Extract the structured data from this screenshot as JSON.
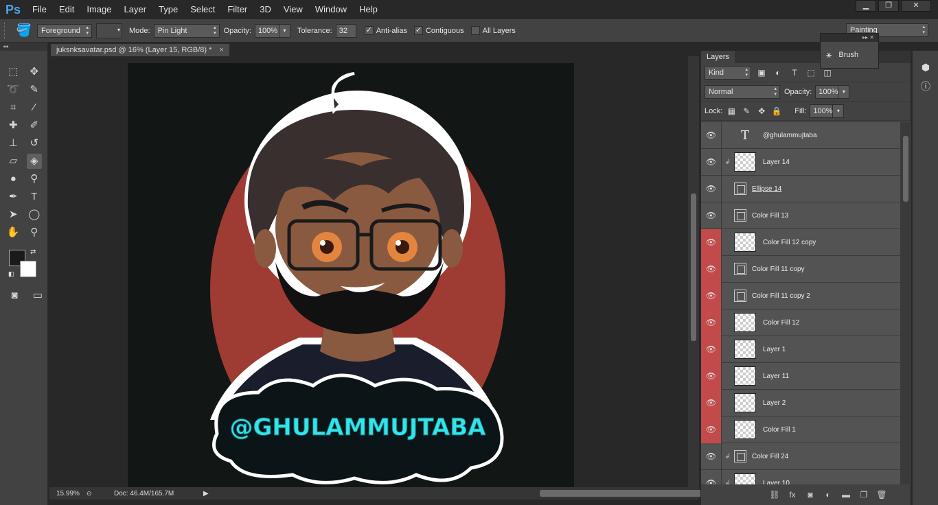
{
  "menubar": {
    "logo": "Ps",
    "items": [
      "File",
      "Edit",
      "Image",
      "Layer",
      "Type",
      "Select",
      "Filter",
      "3D",
      "View",
      "Window",
      "Help"
    ],
    "min": "▁",
    "restore": "❐",
    "close": "✕"
  },
  "options": {
    "fill_source": "Foreground",
    "mode_label": "Mode:",
    "mode_value": "Pin Light",
    "opacity_label": "Opacity:",
    "opacity_value": "100%",
    "tolerance_label": "Tolerance:",
    "tolerance_value": "32",
    "antialias_label": "Anti-alias",
    "contiguous_label": "Contiguous",
    "all_layers_label": "All Layers",
    "workspace": "Painting"
  },
  "document": {
    "tab_title": "juksnksavatar.psd @ 16% (Layer 15, RGB/8) *",
    "close": "×",
    "zoom": "15.99%",
    "doc_size": "Doc: 46.4M/165.7M",
    "artwork_handle": "@GHULAMMUJTABA"
  },
  "colors": {
    "red_circle": "#9e3b33",
    "canvas_bg": "#121614",
    "accent_cyan": "#34e4e8",
    "layer_red": "#c24a4a"
  },
  "brush_panel": {
    "label": "Brush"
  },
  "layers": {
    "tab": "Layers",
    "filter_kind": "Kind",
    "blend_mode": "Normal",
    "opacity_label": "Opacity:",
    "opacity_value": "100%",
    "lock_label": "Lock:",
    "fill_label": "Fill:",
    "fill_value": "100%",
    "items": [
      {
        "name": "@ghulammujtaba",
        "thumb": "text",
        "red": false,
        "clip": false
      },
      {
        "name": "Layer 14",
        "thumb": "checker",
        "red": false,
        "clip": true
      },
      {
        "name": "Ellipse 14",
        "thumb": "shape",
        "red": false,
        "clip": false,
        "underline": true
      },
      {
        "name": "Color Fill 13",
        "thumb": "shape",
        "red": false,
        "clip": false
      },
      {
        "name": "Color Fill 12 copy",
        "thumb": "checker-mask",
        "red": true,
        "clip": false
      },
      {
        "name": "Color Fill 11 copy",
        "thumb": "shape",
        "red": true,
        "clip": false
      },
      {
        "name": "Color Fill 11 copy 2",
        "thumb": "shape",
        "red": true,
        "clip": false
      },
      {
        "name": "Color Fill 12",
        "thumb": "checker-mask",
        "red": true,
        "clip": false
      },
      {
        "name": "Layer 1",
        "thumb": "checker",
        "red": true,
        "clip": false
      },
      {
        "name": "Layer 11",
        "thumb": "checker",
        "red": true,
        "clip": false
      },
      {
        "name": "Layer 2",
        "thumb": "checker",
        "red": true,
        "clip": false
      },
      {
        "name": "Color Fill 1",
        "thumb": "checker-mask",
        "red": true,
        "clip": false
      },
      {
        "name": "Color Fill 24",
        "thumb": "shape",
        "red": false,
        "clip": true
      },
      {
        "name": "Layer 10",
        "thumb": "checker",
        "red": false,
        "clip": true
      }
    ]
  }
}
